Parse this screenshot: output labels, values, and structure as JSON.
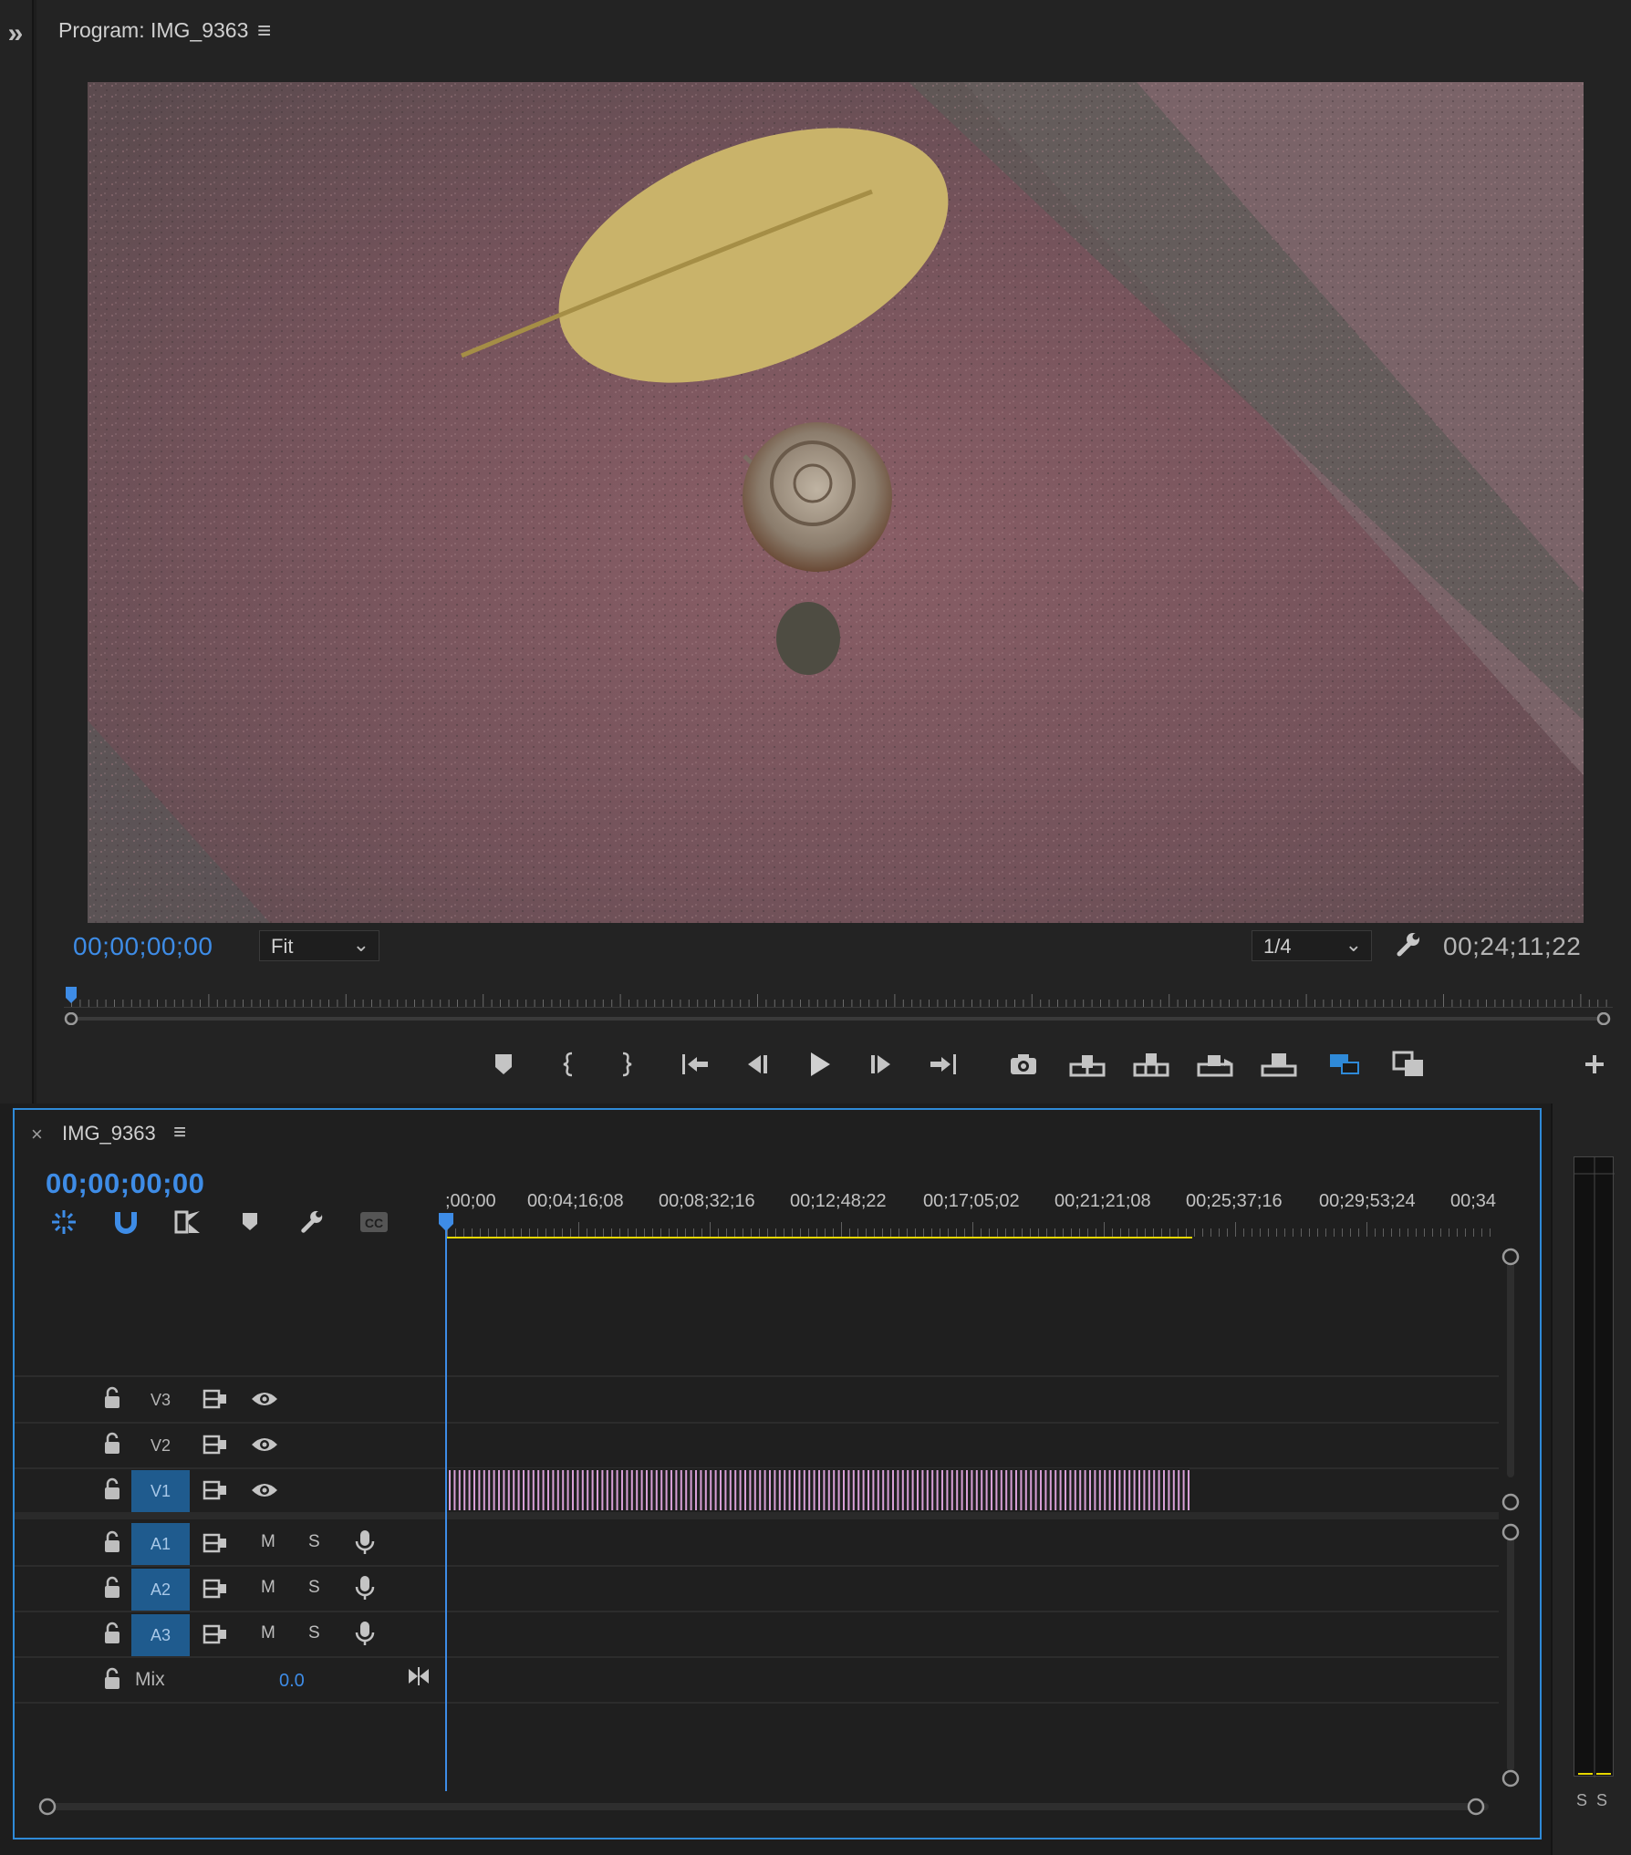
{
  "program": {
    "title": "Program: IMG_9363",
    "timecode_current": "00;00;00;00",
    "timecode_duration": "00;24;11;22",
    "zoom": "Fit",
    "resolution": "1/4"
  },
  "timeline": {
    "sequence_name": "IMG_9363",
    "timecode": "00;00;00;00",
    "ruler_labels": [
      ";00;00",
      "00;04;16;08",
      "00;08;32;16",
      "00;12;48;22",
      "00;17;05;02",
      "00;21;21;08",
      "00;25;37;16",
      "00;29;53;24",
      "00;34"
    ],
    "video_tracks": [
      {
        "name": "V3",
        "active": false
      },
      {
        "name": "V2",
        "active": false
      },
      {
        "name": "V1",
        "active": true
      }
    ],
    "audio_tracks": [
      {
        "name": "A1",
        "active": true,
        "mute": "M",
        "solo": "S"
      },
      {
        "name": "A2",
        "active": true,
        "mute": "M",
        "solo": "S"
      },
      {
        "name": "A3",
        "active": true,
        "mute": "M",
        "solo": "S"
      }
    ],
    "mix": {
      "label": "Mix",
      "value": "0.0"
    },
    "in_out_fraction": 0.71,
    "clip_fraction": 0.71
  },
  "meter": {
    "labels": [
      "S",
      "S"
    ]
  },
  "colors": {
    "accent": "#2f8ad8",
    "timecode": "#3e8ce6",
    "clip": "#d79fd6",
    "work_area": "#e8d800"
  }
}
